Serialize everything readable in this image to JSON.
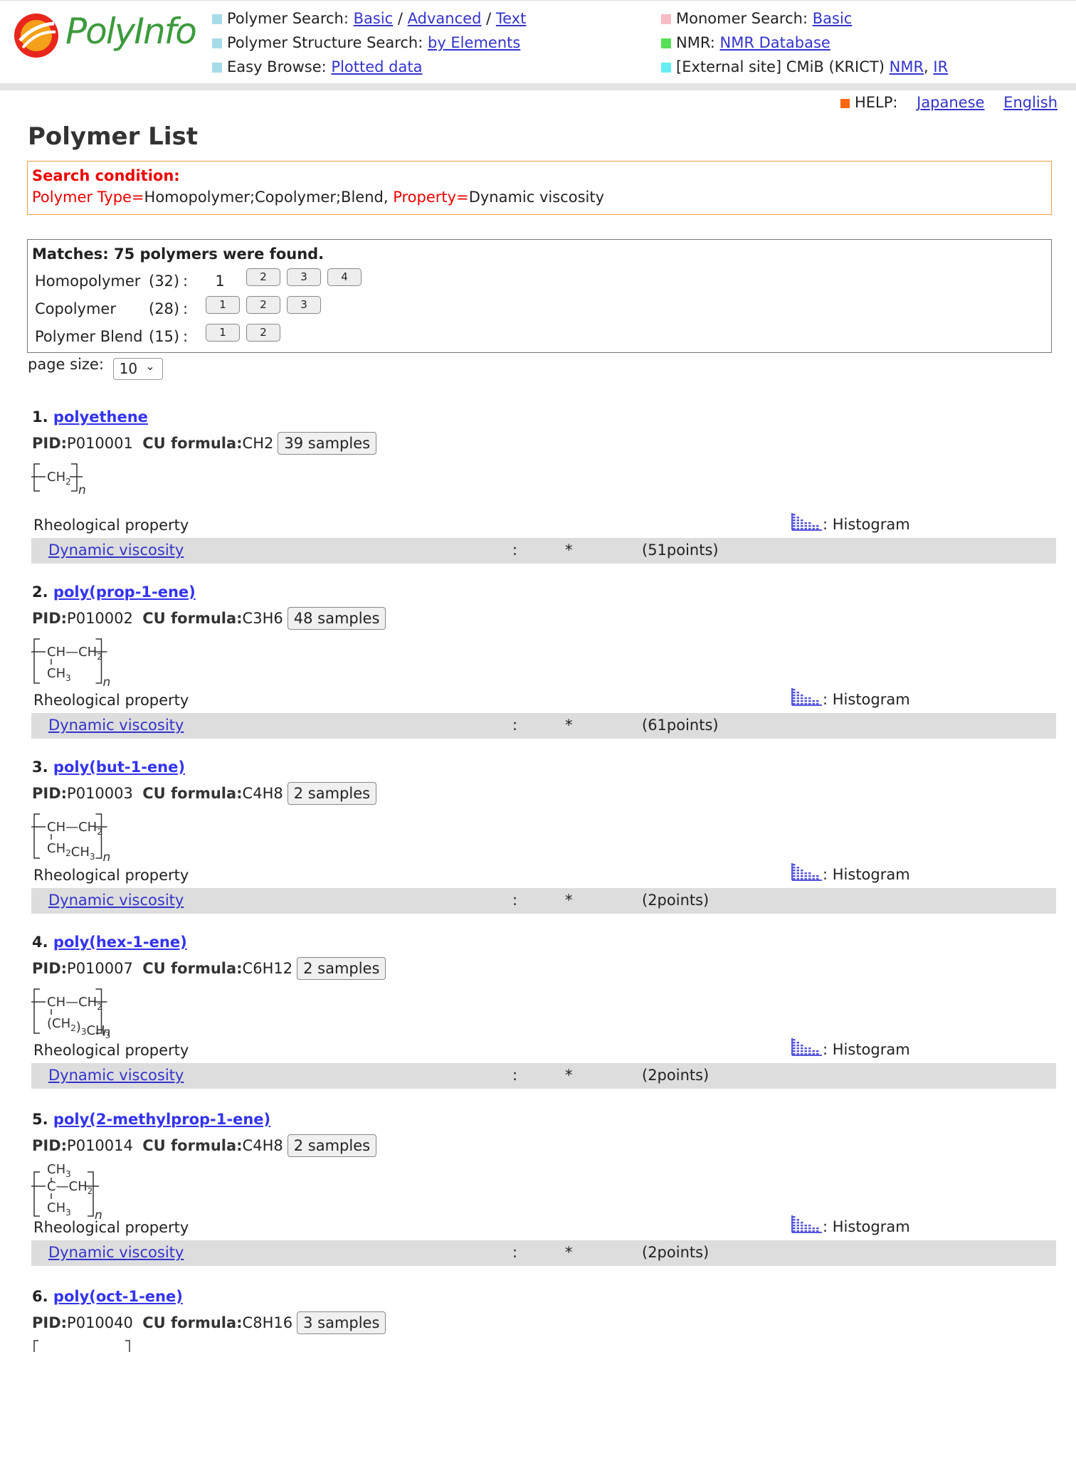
{
  "header": {
    "logo_text": "PolyInfo",
    "nav_left": [
      {
        "label": "Polymer Search:",
        "color": "#a8dbe8",
        "links": [
          "Basic",
          "Advanced",
          "Text"
        ]
      },
      {
        "label": "Polymer Structure Search:",
        "color": "#a8dbe8",
        "links": [
          "by Elements"
        ]
      },
      {
        "label": "Easy Browse:",
        "color": "#a8dbe8",
        "links": [
          "Plotted data"
        ]
      }
    ],
    "nav_right": [
      {
        "label": "Monomer Search:",
        "color": "#f7bcc6",
        "links": [
          "Basic"
        ]
      },
      {
        "label": "NMR:",
        "color": "#55e055",
        "links": [
          "NMR Database"
        ]
      },
      {
        "label": "[External site] CMiB (KRICT)",
        "color": "#66eef2",
        "links": [
          "NMR",
          "IR"
        ]
      }
    ]
  },
  "help": {
    "label": "HELP:",
    "japanese": "Japanese",
    "english": "English",
    "color": "#ff6611"
  },
  "page_title": "Polymer List",
  "search_condition": {
    "title": "Search condition:",
    "polymer_type_key": "Polymer Type=",
    "polymer_type_value": "Homopolymer;Copolymer;Blend,",
    "property_key": "Property=",
    "property_value": "Dynamic viscosity"
  },
  "matches": {
    "header": "Matches: 75 polymers were found.",
    "rows": [
      {
        "label": "Homopolymer",
        "count": "(32)",
        "colon": ":",
        "current": "1",
        "pages": [
          "2",
          "3",
          "4"
        ]
      },
      {
        "label": "Copolymer",
        "count": "(28)",
        "colon": ":",
        "pages": [
          "1",
          "2",
          "3"
        ]
      },
      {
        "label": "Polymer Blend",
        "count": "(15)",
        "colon": ":",
        "pages": [
          "1",
          "2"
        ]
      }
    ]
  },
  "page_size": {
    "label": "page size:",
    "value": "10"
  },
  "entries": [
    {
      "num": "1.",
      "name": "polyethene",
      "pid_label": "PID:",
      "pid": "P010001",
      "formula_label": "CU formula:",
      "formula": "CH2",
      "samples": "39 samples",
      "section": "Rheological property",
      "hist_label": ": Histogram",
      "property": "Dynamic viscosity",
      "colon": ":",
      "star": "*",
      "points": "(51points)"
    },
    {
      "num": "2.",
      "name": "poly(prop-1-ene)",
      "pid_label": "PID:",
      "pid": "P010002",
      "formula_label": "CU formula:",
      "formula": "C3H6",
      "samples": "48 samples",
      "section": "Rheological property",
      "hist_label": ": Histogram",
      "property": "Dynamic viscosity",
      "colon": ":",
      "star": "*",
      "points": "(61points)"
    },
    {
      "num": "3.",
      "name": "poly(but-1-ene)",
      "pid_label": "PID:",
      "pid": "P010003",
      "formula_label": "CU formula:",
      "formula": "C4H8",
      "samples": "2 samples",
      "section": "Rheological property",
      "hist_label": ": Histogram",
      "property": "Dynamic viscosity",
      "colon": ":",
      "star": "*",
      "points": "(2points)"
    },
    {
      "num": "4.",
      "name": "poly(hex-1-ene)",
      "pid_label": "PID:",
      "pid": "P010007",
      "formula_label": "CU formula:",
      "formula": "C6H12",
      "samples": "2 samples",
      "section": "Rheological property",
      "hist_label": ": Histogram",
      "property": "Dynamic viscosity",
      "colon": ":",
      "star": "*",
      "points": "(2points)"
    },
    {
      "num": "5.",
      "name": "poly(2-methylprop-1-ene)",
      "pid_label": "PID:",
      "pid": "P010014",
      "formula_label": "CU formula:",
      "formula": "C4H8",
      "samples": "2 samples",
      "section": "Rheological property",
      "hist_label": ": Histogram",
      "property": "Dynamic viscosity",
      "colon": ":",
      "star": "*",
      "points": "(2points)"
    },
    {
      "num": "6.",
      "name": "poly(oct-1-ene)",
      "pid_label": "PID:",
      "pid": "P010040",
      "formula_label": "CU formula:",
      "formula": "C8H16",
      "samples": "3 samples"
    }
  ],
  "structures": [
    {
      "main": "CH2",
      "side": ""
    },
    {
      "main": "CH—CH2",
      "side": "CH3"
    },
    {
      "main": "CH—CH2",
      "side": "CH2CH3"
    },
    {
      "main": "CH—CH2",
      "side": "(CH2)3CH3"
    },
    {
      "main": "C—CH2",
      "top": "CH3",
      "side": "CH3"
    }
  ],
  "colors": {
    "link": "#3333cc",
    "condition_red": "#ee0000",
    "row_bg": "#dddddd",
    "histogram_icon": "#5555dd"
  }
}
